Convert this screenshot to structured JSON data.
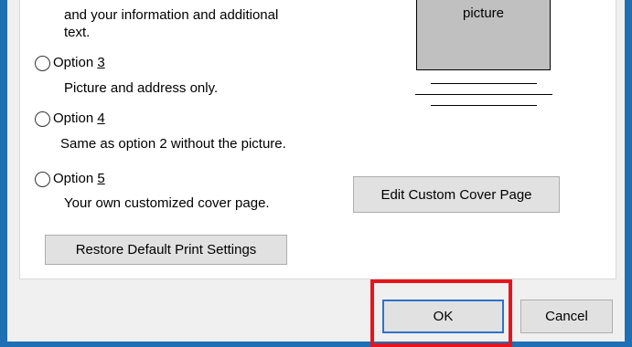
{
  "option2_description": {
    "line1": "and your information and additional",
    "line2": "text."
  },
  "preview": {
    "label": "picture"
  },
  "options": [
    {
      "prefix": "Option ",
      "number": "3",
      "description": "Picture and address only."
    },
    {
      "prefix": "Option ",
      "number": "4",
      "description": "Same as option 2 without the picture."
    },
    {
      "prefix": "Option ",
      "number": "5",
      "description": "Your own customized cover page."
    }
  ],
  "buttons": {
    "edit_custom_cover_page": "Edit Custom Cover Page",
    "restore_default_print_settings": "Restore Default Print Settings",
    "ok": "OK",
    "cancel": "Cancel"
  },
  "colors": {
    "highlight": "#e8141c",
    "frame": "#1f6fb5"
  }
}
